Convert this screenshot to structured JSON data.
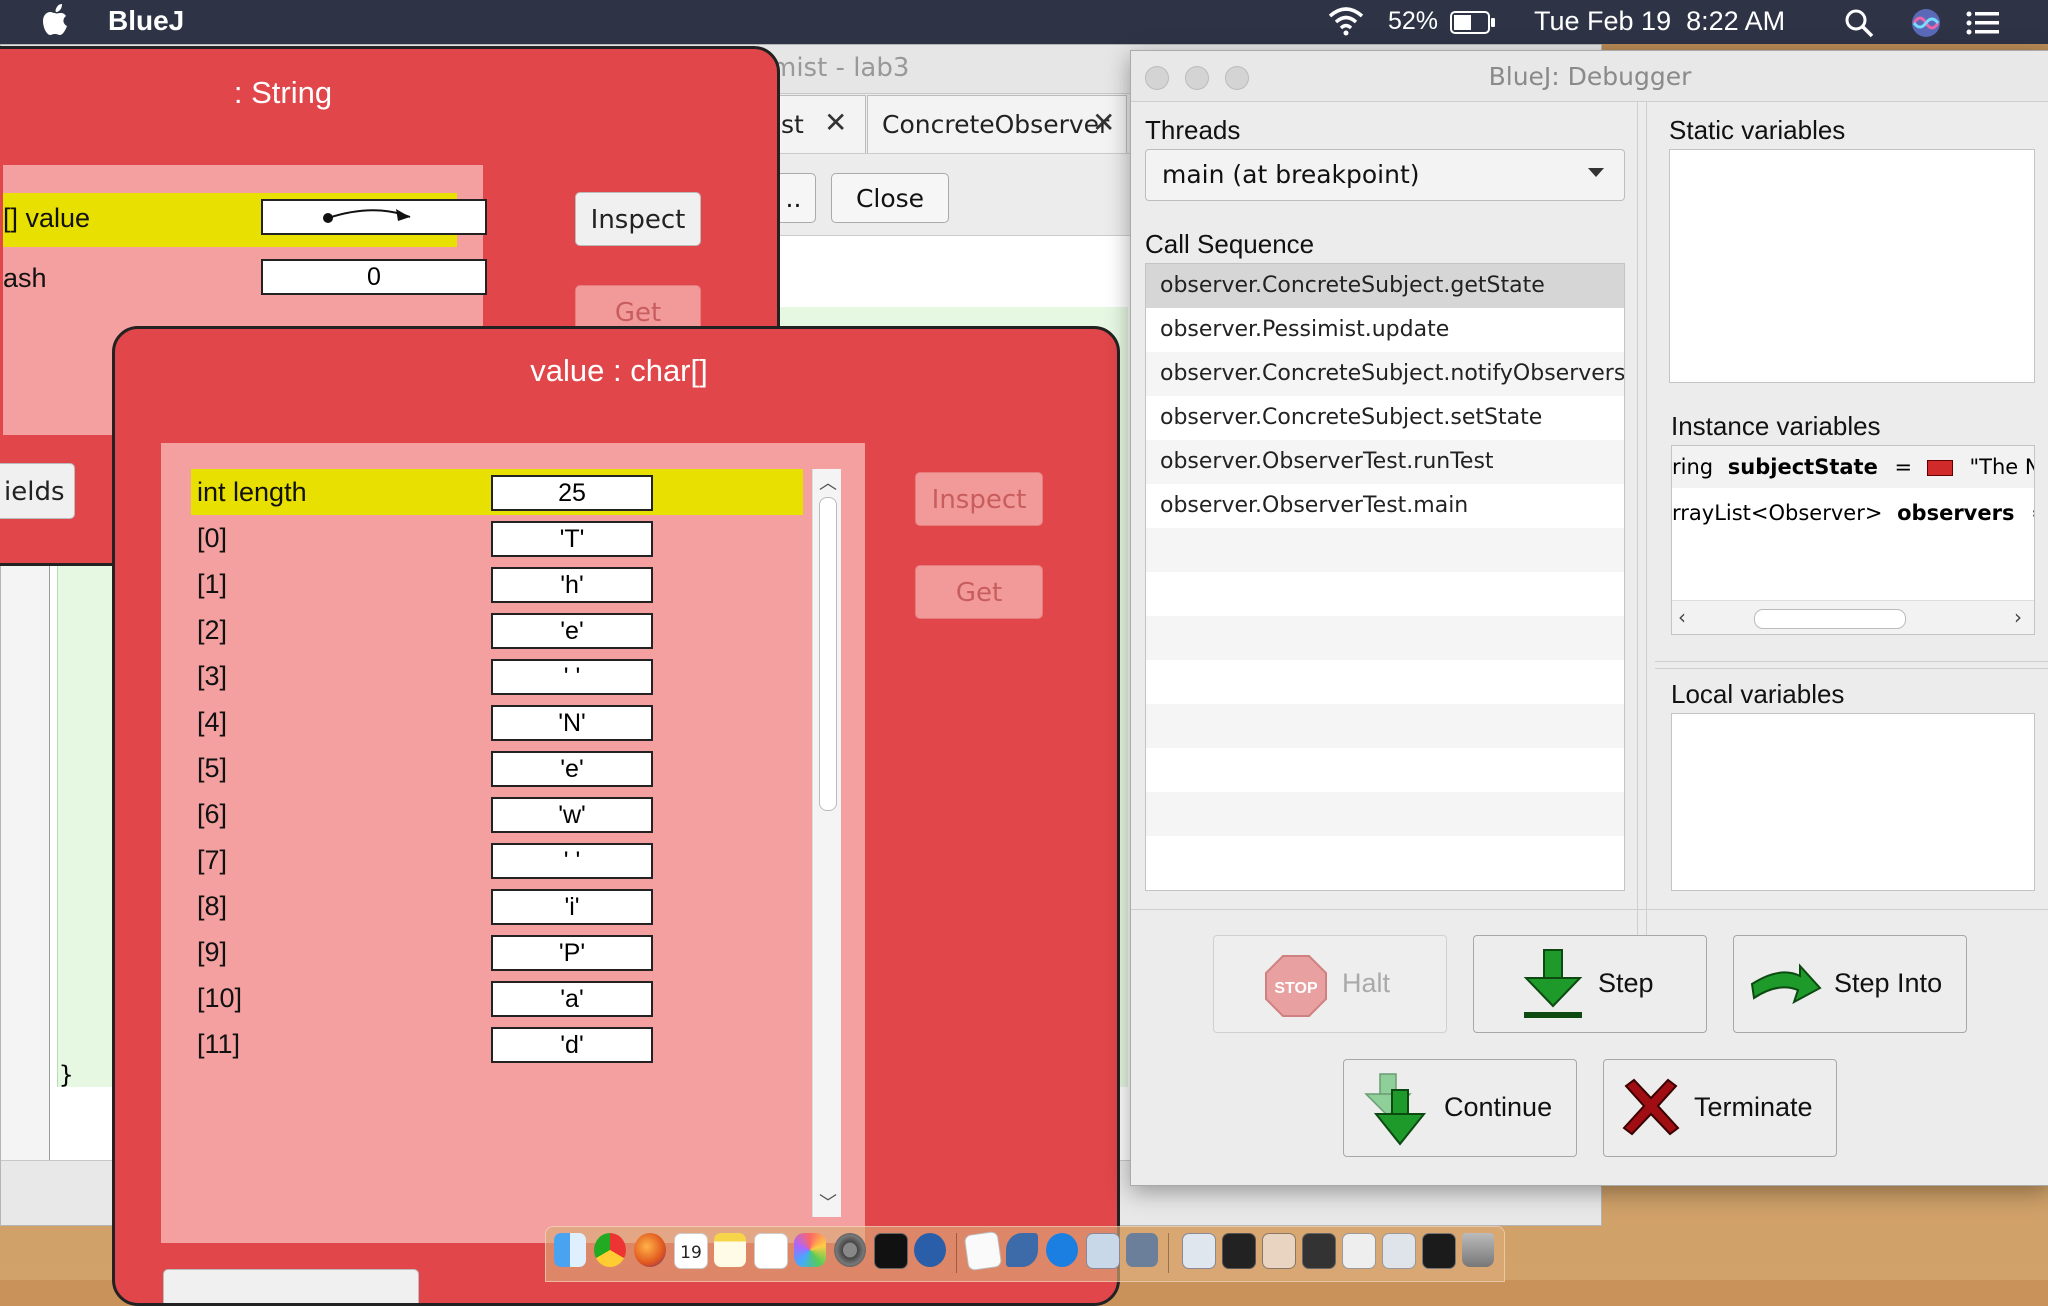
{
  "menubar": {
    "app_name": "BlueJ",
    "battery": "52%",
    "clock": "Tue Feb 19  8:22 AM"
  },
  "editor": {
    "title": "mist - lab3",
    "tabs": [
      {
        "label": "ist"
      },
      {
        "label": "ConcreteObserver"
      }
    ],
    "toolbar": {
      "partial_label": "..",
      "close_label": "Close"
    },
    "code_closing_brace": "}"
  },
  "string_inspector": {
    "title": ": String",
    "fields": [
      {
        "label": "[] value",
        "value": ""
      },
      {
        "label": "ash",
        "value": "0"
      }
    ],
    "inspect_label": "Inspect",
    "get_label": "Get",
    "show_fields_label": "ields"
  },
  "array_inspector": {
    "title": "value : char[]",
    "fields": [
      {
        "label": "int length",
        "value": "25"
      },
      {
        "label": "[0]",
        "value": "'T'"
      },
      {
        "label": "[1]",
        "value": "'h'"
      },
      {
        "label": "[2]",
        "value": "'e'"
      },
      {
        "label": "[3]",
        "value": "' '"
      },
      {
        "label": "[4]",
        "value": "'N'"
      },
      {
        "label": "[5]",
        "value": "'e'"
      },
      {
        "label": "[6]",
        "value": "'w'"
      },
      {
        "label": "[7]",
        "value": "' '"
      },
      {
        "label": "[8]",
        "value": "'i'"
      },
      {
        "label": "[9]",
        "value": "'P'"
      },
      {
        "label": "[10]",
        "value": "'a'"
      },
      {
        "label": "[11]",
        "value": "'d'"
      }
    ],
    "inspect_label": "Inspect",
    "get_label": "Get"
  },
  "debugger": {
    "title": "BlueJ:  Debugger",
    "threads_label": "Threads",
    "thread_selected": "main (at breakpoint)",
    "call_sequence_label": "Call Sequence",
    "call_sequence": [
      "observer.ConcreteSubject.getState",
      "observer.Pessimist.update",
      "observer.ConcreteSubject.notifyObservers",
      "observer.ConcreteSubject.setState",
      "observer.ObserverTest.runTest",
      "observer.ObserverTest.main"
    ],
    "static_label": "Static variables",
    "instance_label": "Instance variables",
    "instance_vars": [
      {
        "type": "ring",
        "name": "subjectState",
        "eq": "=",
        "value": "\"The New"
      },
      {
        "type": "rrayList<Observer>",
        "name": "observers",
        "eq": "=",
        "value": ""
      }
    ],
    "local_label": "Local variables",
    "buttons": {
      "halt": "Halt",
      "stop_sign": "STOP",
      "step": "Step",
      "step_into": "Step Into",
      "continue": "Continue",
      "terminate": "Terminate"
    }
  },
  "dock": {
    "calendar_day": "19"
  },
  "colors": {
    "inspector_red": "#e0464a",
    "inspector_pane": "#f4a0a0",
    "highlight_yellow": "#e8e000",
    "menubar": "#2e3446"
  }
}
